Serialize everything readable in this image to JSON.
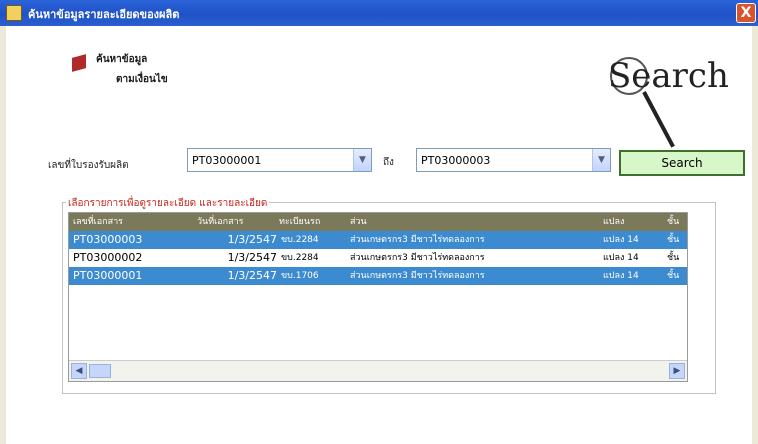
{
  "window": {
    "title": "ค้นหาข้อมูลรายละเอียดของผลิต",
    "close_label": "X"
  },
  "header": {
    "line1": "ค้นหาข้อมูล",
    "line2": "ตามเงื่อนไข"
  },
  "logo": {
    "text": "Search"
  },
  "filter": {
    "label": "เลขที่ใบรองรับผลิต",
    "from_value": "PT03000001",
    "to_label": "ถึง",
    "to_value": "PT03000003",
    "dropdown_glyph": "▼"
  },
  "search_button": {
    "label": "Search"
  },
  "results": {
    "group_title": "เลือกรายการเพื่อดูรายละเอียด และรายละเอียด",
    "columns": [
      "เลขที่เอกสาร",
      "วันที่เอกสาร",
      "ทะเบียนรถ",
      "ส่วน",
      "แปลง",
      "ชั้น"
    ],
    "rows": [
      {
        "doc": "PT03000003",
        "date": "1/3/2547",
        "reg": "ขบ.2284",
        "section": "ส่วนเกษตรกร3 มีชาวไร่ทดลองการ",
        "plot": "แปลง 14",
        "grade": "ชั้น",
        "selected": true
      },
      {
        "doc": "PT03000002",
        "date": "1/3/2547",
        "reg": "ขบ.2284",
        "section": "ส่วนเกษตรกร3 มีชาวไร่ทดลองการ",
        "plot": "แปลง 14",
        "grade": "ชั้น",
        "selected": false
      },
      {
        "doc": "PT03000001",
        "date": "1/3/2547",
        "reg": "ขบ.1706",
        "section": "ส่วนเกษตรกร3 มีชาวไร่ทดลองการ",
        "plot": "แปลง 14",
        "grade": "ชั้น",
        "selected": true
      }
    ],
    "scroll_left": "◀",
    "scroll_right": "▶"
  }
}
